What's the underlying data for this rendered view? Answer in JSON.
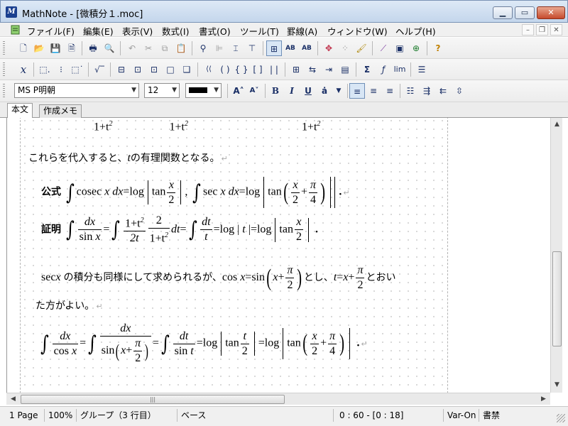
{
  "window": {
    "title": "MathNote - [微積分１.moc]",
    "app_icon": "math-app-icon",
    "controls": [
      "minimize-icon",
      "maximize-icon",
      "close-icon"
    ]
  },
  "menu": {
    "items": [
      "ファイル(F)",
      "編集(E)",
      "表示(V)",
      "数式(I)",
      "書式(O)",
      "ツール(T)",
      "罫線(A)",
      "ウィンドウ(W)",
      "ヘルプ(H)"
    ]
  },
  "toolbar3": {
    "font": "MS P明朝",
    "size": "12"
  },
  "tabs": [
    "本文",
    "作成メモ"
  ],
  "document": {
    "top_partial": {
      "f1_num": "1+t",
      "f2_num": "1+t",
      "f3_num": "1+t",
      "sup": "2"
    },
    "text1": "これらを代入すると、",
    "text1_var": "t",
    "text1_end": "の有理関数となる。",
    "formula_label": "公式",
    "cosec": "cosec",
    "log": "=log",
    "tan": "tan",
    "sec": "sec",
    "proof_label": "証明",
    "sin": "sin",
    "cos": "cos",
    "one_plus_t2": "1+t",
    "two": "2",
    "two_t": "2t",
    "pi": "π",
    "four": "4",
    "text2a": "の積分も同様にして求められるが、",
    "text2b": "とし、",
    "text2c": "とおい",
    "text3": "た方がよい。"
  },
  "status": {
    "page": "1 Page",
    "zoom": "100%",
    "group": "グループ（3 行目）",
    "base": "ベース",
    "position": "0 : 60 - [0 : 18]",
    "var": "Var-On",
    "mode": "書禁"
  }
}
